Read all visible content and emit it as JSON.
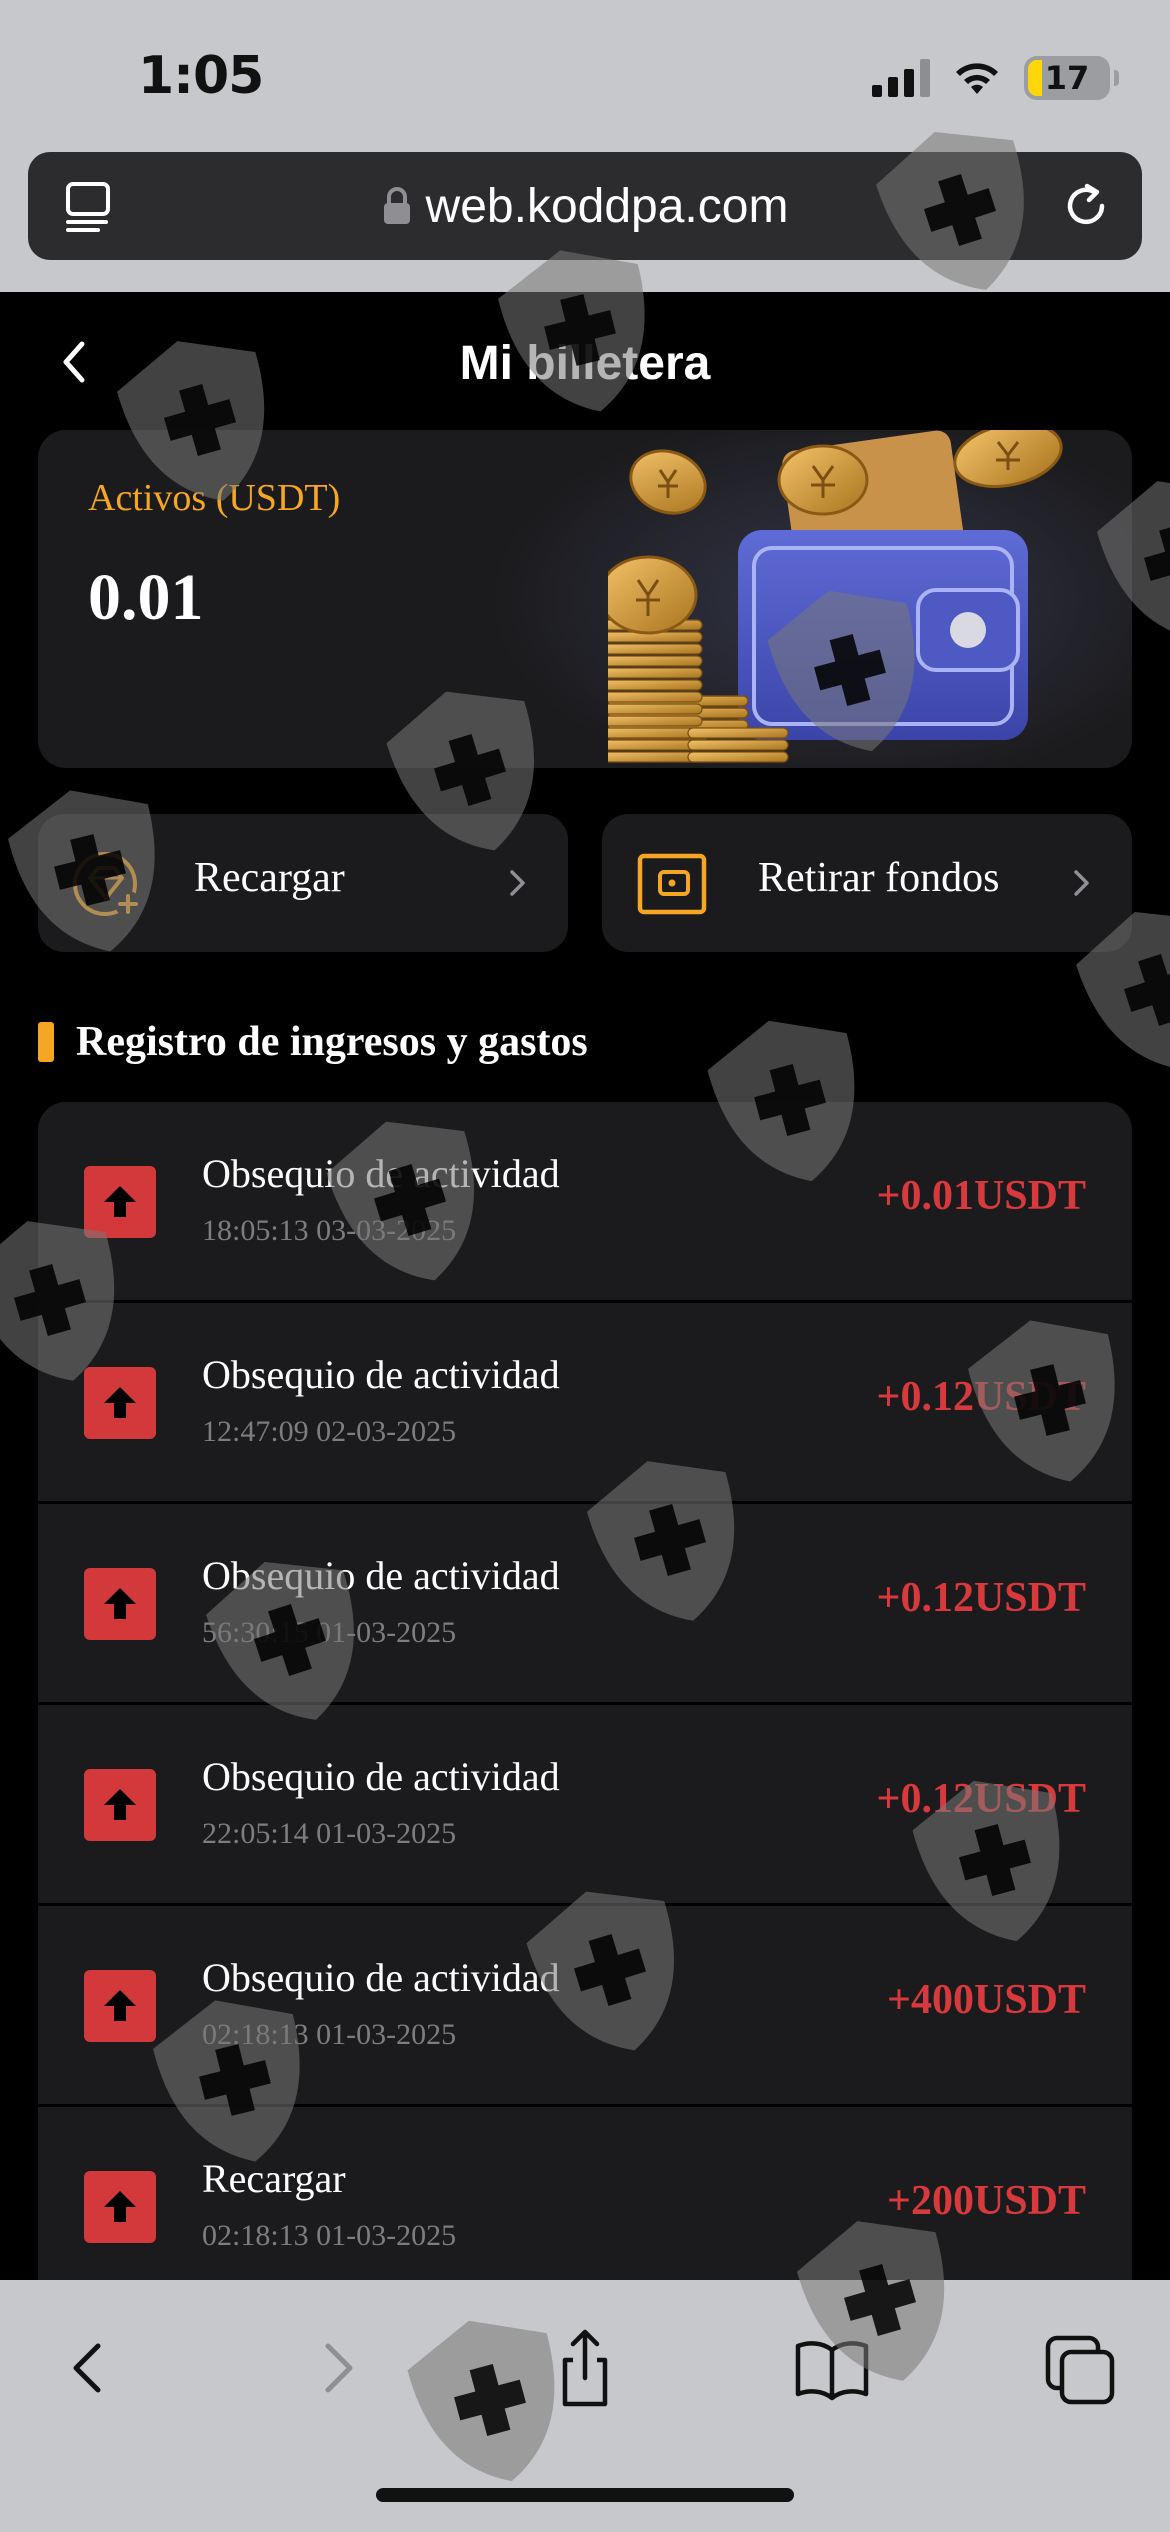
{
  "status_bar": {
    "time": "1:05",
    "battery": "17"
  },
  "browser": {
    "url": "web.koddpa.com"
  },
  "header": {
    "title": "Mi billetera"
  },
  "assets": {
    "label": "Activos (USDT)",
    "value": "0.01"
  },
  "actions": {
    "recharge_label": "Recargar",
    "withdraw_label": "Retirar fondos"
  },
  "records_section": {
    "title": "Registro de ingresos y gastos",
    "items": [
      {
        "name": "Obsequio de actividad",
        "time": "18:05:13 03-03-2025",
        "amount": "+0.01USDT"
      },
      {
        "name": "Obsequio de actividad",
        "time": "12:47:09 02-03-2025",
        "amount": "+0.12USDT"
      },
      {
        "name": "Obsequio de actividad",
        "time": "56:30:15 01-03-2025",
        "amount": "+0.12USDT"
      },
      {
        "name": "Obsequio de actividad",
        "time": "22:05:14 01-03-2025",
        "amount": "+0.12USDT"
      },
      {
        "name": "Obsequio de actividad",
        "time": "02:18:13 01-03-2025",
        "amount": "+400USDT"
      },
      {
        "name": "Recargar",
        "time": "02:18:13 01-03-2025",
        "amount": "+200USDT"
      }
    ]
  },
  "colors": {
    "accent": "#f5a623",
    "amount": "#d8393c",
    "card": "#1b1b1d",
    "record_icon": "#d3393b"
  }
}
